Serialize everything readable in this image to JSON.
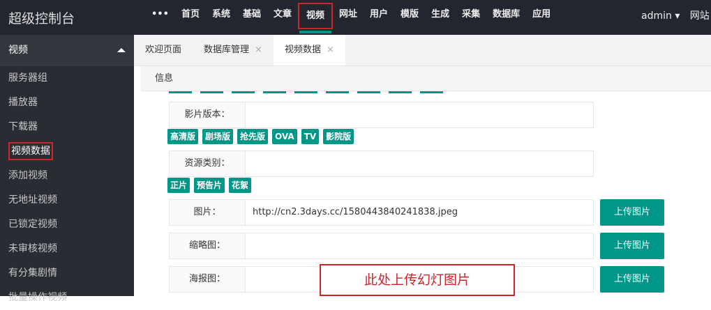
{
  "header": {
    "title": "超级控制台",
    "more": "•••",
    "nav": [
      "首页",
      "系统",
      "基础",
      "文章",
      "视频",
      "网址",
      "用户",
      "模版",
      "生成",
      "采集",
      "数据库",
      "应用"
    ],
    "active": "视频",
    "user": "admin ▾",
    "site": "网站"
  },
  "sidebar": {
    "section": "视频",
    "items": [
      "服务器组",
      "播放器",
      "下载器",
      "视频数据",
      "添加视频",
      "无地址视频",
      "已锁定视频",
      "未审核视频",
      "有分集剧情",
      "批量操作视频"
    ],
    "selected": "视频数据"
  },
  "tabs": [
    {
      "label": "欢迎页面"
    },
    {
      "label": "数据库管理",
      "close": "×"
    },
    {
      "label": "视频数据",
      "close": "×"
    }
  ],
  "info_tab": "信息",
  "form": {
    "version_label": "影片版本：",
    "version_value": "",
    "version_tags": [
      "高清版",
      "剧场版",
      "抢先版",
      "OVA",
      "TV",
      "影院版"
    ],
    "type_label": "资源类别：",
    "type_value": "",
    "type_tags": [
      "正片",
      "预告片",
      "花絮"
    ],
    "image_label": "图片：",
    "image_value": "http://cn2.3days.cc/1580443840241838.jpeg",
    "thumb_label": "缩略图：",
    "thumb_value": "",
    "poster_label": "海报图：",
    "poster_value": "",
    "upload_label": "上传图片"
  },
  "annotation": "此处上传幻灯图片",
  "colors": {
    "accent": "#009688",
    "highlight": "#d0242b",
    "topbar": "#23262e"
  }
}
